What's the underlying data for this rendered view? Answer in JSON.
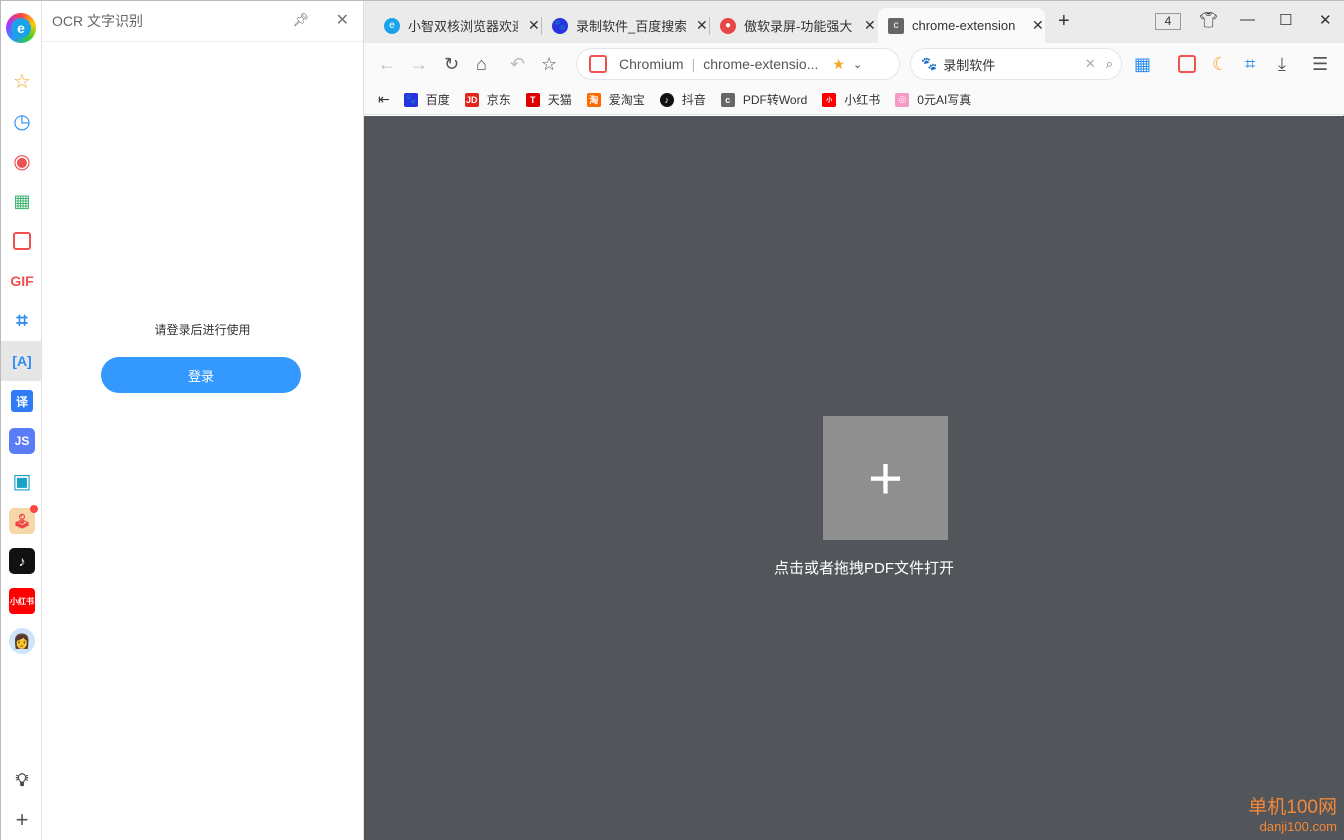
{
  "rail": {
    "items": [
      "browser-logo",
      "star",
      "history",
      "record",
      "qrcode",
      "pdf",
      "gif",
      "crop",
      "ocr",
      "translate",
      "js",
      "screen",
      "game",
      "douyin",
      "xiaohongshu",
      "avatar",
      "bulb",
      "add"
    ],
    "gif_label": "GIF",
    "translate_label": "译",
    "xhs_label": "小红书"
  },
  "panel": {
    "title": "OCR 文字识别",
    "message": "请登录后进行使用",
    "login_label": "登录"
  },
  "tabs": [
    {
      "title": "小智双核浏览器欢迎",
      "color": "#1aa3e8"
    },
    {
      "title": "录制软件_百度搜索",
      "color": "#2932e1"
    },
    {
      "title": "傲软录屏-功能强大",
      "color": "#e84545"
    },
    {
      "title": "chrome-extension",
      "color": "#666666",
      "active": true
    }
  ],
  "tab_count": "4",
  "address": {
    "site": "Chromium",
    "url": "chrome-extensio..."
  },
  "search": {
    "value": "录制软件"
  },
  "bookmarks": [
    {
      "label": "百度",
      "color": "#2932e1",
      "g": "🐾"
    },
    {
      "label": "京东",
      "color": "#e1251b",
      "g": "JD"
    },
    {
      "label": "天猫",
      "color": "#d00",
      "g": "T"
    },
    {
      "label": "爱淘宝",
      "color": "#ff6a00",
      "g": "淘"
    },
    {
      "label": "抖音",
      "color": "#111",
      "g": "♪"
    },
    {
      "label": "PDF转Word",
      "color": "#666",
      "g": "c"
    },
    {
      "label": "小红书",
      "color": "#f00",
      "g": "小"
    },
    {
      "label": "0元AI写真",
      "color": "#f59ac6",
      "g": "◎"
    }
  ],
  "content": {
    "hint": "点击或者拖拽PDF文件打开"
  },
  "watermark": {
    "line1": "单机100网",
    "line2": "danji100.com"
  }
}
